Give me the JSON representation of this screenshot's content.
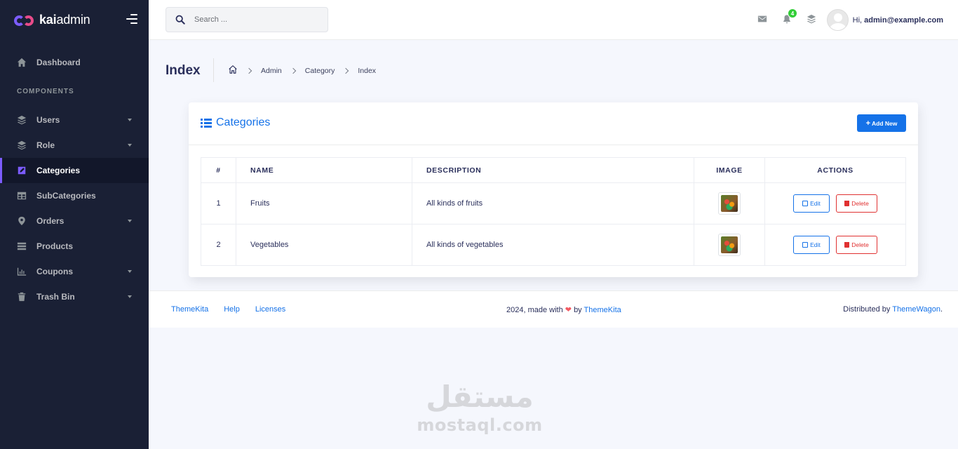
{
  "brand": {
    "name_bold": "kai",
    "name_rest": "admin"
  },
  "sidebar": {
    "section_label": "COMPONENTS",
    "items": [
      {
        "label": "Dashboard",
        "icon": "home-icon",
        "has_caret": false
      },
      {
        "label": "Users",
        "icon": "layers-icon",
        "has_caret": true
      },
      {
        "label": "Role",
        "icon": "layers-icon",
        "has_caret": true
      },
      {
        "label": "Categories",
        "icon": "edit-square-icon",
        "has_caret": false,
        "active": true
      },
      {
        "label": "SubCategories",
        "icon": "table-icon",
        "has_caret": false
      },
      {
        "label": "Orders",
        "icon": "map-pin-icon",
        "has_caret": true
      },
      {
        "label": "Products",
        "icon": "list-icon",
        "has_caret": false
      },
      {
        "label": "Coupons",
        "icon": "bar-chart-icon",
        "has_caret": true
      },
      {
        "label": "Trash Bin",
        "icon": "trash-icon",
        "has_caret": true
      }
    ]
  },
  "topbar": {
    "search_placeholder": "Search ...",
    "notification_count": "4",
    "greeting": "Hi,",
    "user_email": "admin@example.com"
  },
  "page": {
    "title": "Index",
    "breadcrumb": [
      "Admin",
      "Category",
      "Index"
    ]
  },
  "card": {
    "title": "Categories",
    "add_button": "Add New",
    "columns": [
      "#",
      "NAME",
      "DESCRIPTION",
      "IMAGE",
      "ACTIONS"
    ],
    "rows": [
      {
        "num": "1",
        "name": "Fruits",
        "description": "All kinds of fruits"
      },
      {
        "num": "2",
        "name": "Vegetables",
        "description": "All kinds of vegetables"
      }
    ],
    "edit_label": "Edit",
    "delete_label": "Delete"
  },
  "footer": {
    "links": [
      "ThemeKita",
      "Help",
      "Licenses"
    ],
    "center_prefix": "2024, made with",
    "center_by": "by",
    "center_link": "ThemeKita",
    "right_prefix": "Distributed by",
    "right_link": "ThemeWagon",
    "right_suffix": "."
  },
  "watermark": {
    "arabic": "مستقل",
    "latin": "mostaql.com"
  },
  "colors": {
    "primary": "#1572e8",
    "danger": "#e03131",
    "sidebar": "#1a2035",
    "accent": "#7c5cff",
    "success": "#31ce36"
  }
}
